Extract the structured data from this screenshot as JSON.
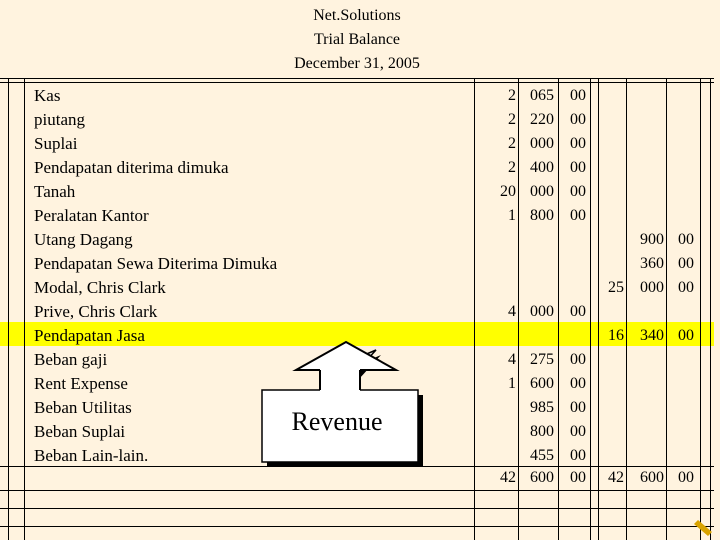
{
  "header": {
    "company": "Net.Solutions",
    "report": "Trial Balance",
    "date": "December 31, 2005"
  },
  "accounts": [
    {
      "name": "Kas",
      "debit": [
        "2",
        "065",
        "00"
      ],
      "credit": [
        "",
        "",
        ""
      ]
    },
    {
      "name": "piutang",
      "debit": [
        "2",
        "220",
        "00"
      ],
      "credit": [
        "",
        "",
        ""
      ]
    },
    {
      "name": "Suplai",
      "debit": [
        "2",
        "000",
        "00"
      ],
      "credit": [
        "",
        "",
        ""
      ]
    },
    {
      "name": "Pendapatan diterima dimuka",
      "debit": [
        "2",
        "400",
        "00"
      ],
      "credit": [
        "",
        "",
        ""
      ]
    },
    {
      "name": "Tanah",
      "debit": [
        "20",
        "000",
        "00"
      ],
      "credit": [
        "",
        "",
        ""
      ]
    },
    {
      "name": "Peralatan Kantor",
      "debit": [
        "1",
        "800",
        "00"
      ],
      "credit": [
        "",
        "",
        ""
      ]
    },
    {
      "name": "Utang Dagang",
      "debit": [
        "",
        "",
        ""
      ],
      "credit": [
        "",
        "900",
        "00"
      ]
    },
    {
      "name": "Pendapatan Sewa Diterima Dimuka",
      "debit": [
        "",
        "",
        ""
      ],
      "credit": [
        "",
        "360",
        "00"
      ]
    },
    {
      "name": "Modal, Chris Clark",
      "debit": [
        "",
        "",
        ""
      ],
      "credit": [
        "25",
        "000",
        "00"
      ]
    },
    {
      "name": "Prive, Chris Clark",
      "debit": [
        "4",
        "000",
        "00"
      ],
      "credit": [
        "",
        "",
        ""
      ]
    },
    {
      "name": "Pendapatan Jasa",
      "debit": [
        "",
        "",
        ""
      ],
      "credit": [
        "16",
        "340",
        "00"
      ]
    },
    {
      "name": "Beban gaji",
      "debit": [
        "4",
        "275",
        "00"
      ],
      "credit": [
        "",
        "",
        ""
      ]
    },
    {
      "name": "Rent Expense",
      "debit": [
        "1",
        "600",
        "00"
      ],
      "credit": [
        "",
        "",
        ""
      ]
    },
    {
      "name": "Beban Utilitas",
      "debit": [
        "",
        "985",
        "00"
      ],
      "credit": [
        "",
        "",
        ""
      ]
    },
    {
      "name": "Beban Suplai",
      "debit": [
        "",
        "800",
        "00"
      ],
      "credit": [
        "",
        "",
        ""
      ]
    },
    {
      "name": "Beban Lain-lain.",
      "debit": [
        "",
        "455",
        "00"
      ],
      "credit": [
        "",
        "",
        ""
      ]
    }
  ],
  "totals": {
    "debit": [
      "42",
      "600",
      "00"
    ],
    "credit": [
      "42",
      "600",
      "00"
    ]
  },
  "callout": {
    "text": "Revenue"
  },
  "colors": {
    "background": "#fff3df",
    "highlight": "#ffff00",
    "callout_fill": "#ffffff",
    "callout_shadow": "#000000"
  }
}
